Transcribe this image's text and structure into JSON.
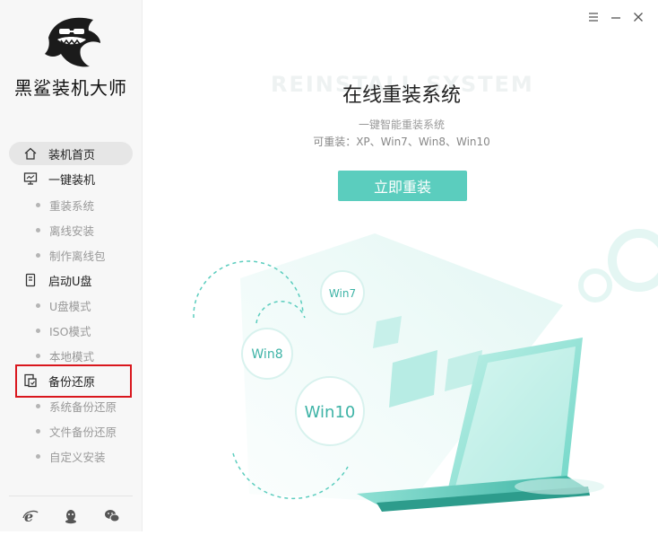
{
  "app": {
    "brand": "黑鲨装机大师"
  },
  "sidebar": {
    "items": [
      {
        "label": "装机首页",
        "icon": "home-icon"
      },
      {
        "label": "一键装机",
        "icon": "monitor-icon"
      },
      {
        "label": "启动U盘",
        "icon": "usb-drive-icon"
      },
      {
        "label": "备份还原",
        "icon": "backup-icon"
      }
    ],
    "subitems": {
      "install": [
        "重装系统",
        "离线安装",
        "制作离线包"
      ],
      "usb": [
        "U盘模式",
        "ISO模式",
        "本地模式"
      ],
      "backup": [
        "系统备份还原",
        "文件备份还原",
        "自定义安装"
      ]
    },
    "bottom_icons": [
      "ie-browser-icon",
      "qq-icon",
      "wechat-icon"
    ]
  },
  "window_controls": [
    "menu-icon",
    "minimize-icon",
    "close-icon"
  ],
  "main": {
    "bg_text": "REINSTALL   SYSTEM",
    "title": "在线重装系统",
    "subtitle": "一键智能重装系统",
    "supported": "可重装：XP、Win7、Win8、Win10",
    "cta": "立即重装",
    "bubbles": [
      "Win7",
      "Win8",
      "Win10"
    ]
  },
  "colors": {
    "accent": "#5bcdbe",
    "highlight": "#d9161d"
  }
}
